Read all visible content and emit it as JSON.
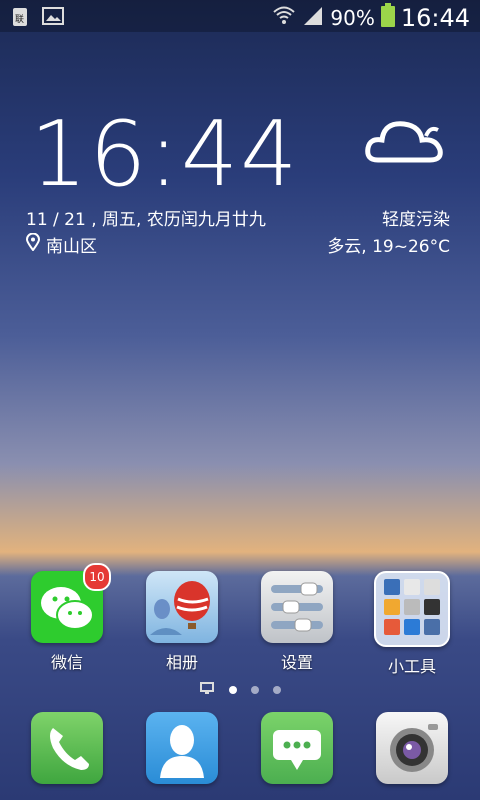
{
  "status_bar": {
    "battery_percent": "90%",
    "time": "16:44",
    "icons": [
      "sim-card-icon",
      "gallery-notification-icon",
      "wifi-icon",
      "signal-icon",
      "battery-icon"
    ]
  },
  "lock_widget": {
    "time": "16:44",
    "date": "11 / 21 , 周五, 农历闰九月廿九",
    "location": "南山区",
    "air_quality": "轻度污染",
    "weather": "多云, 19~26°C"
  },
  "home_apps": [
    {
      "label": "微信",
      "badge": "10",
      "icon": "wechat-icon"
    },
    {
      "label": "相册",
      "icon": "gallery-icon"
    },
    {
      "label": "设置",
      "icon": "settings-icon"
    },
    {
      "label": "小工具",
      "icon": "tools-folder-icon"
    }
  ],
  "page_indicator": {
    "pages": 3,
    "active_index": 0
  },
  "dock_apps": [
    {
      "label": "Phone",
      "icon": "phone-icon"
    },
    {
      "label": "Contacts",
      "icon": "contacts-icon"
    },
    {
      "label": "Messages",
      "icon": "messages-icon"
    },
    {
      "label": "Camera",
      "icon": "camera-icon"
    }
  ],
  "colors": {
    "wechat": "#2ecc2e",
    "contacts": "#2a8cd6",
    "phone": "#3fa63f",
    "messages": "#4caf50",
    "badge": "#e53935"
  }
}
